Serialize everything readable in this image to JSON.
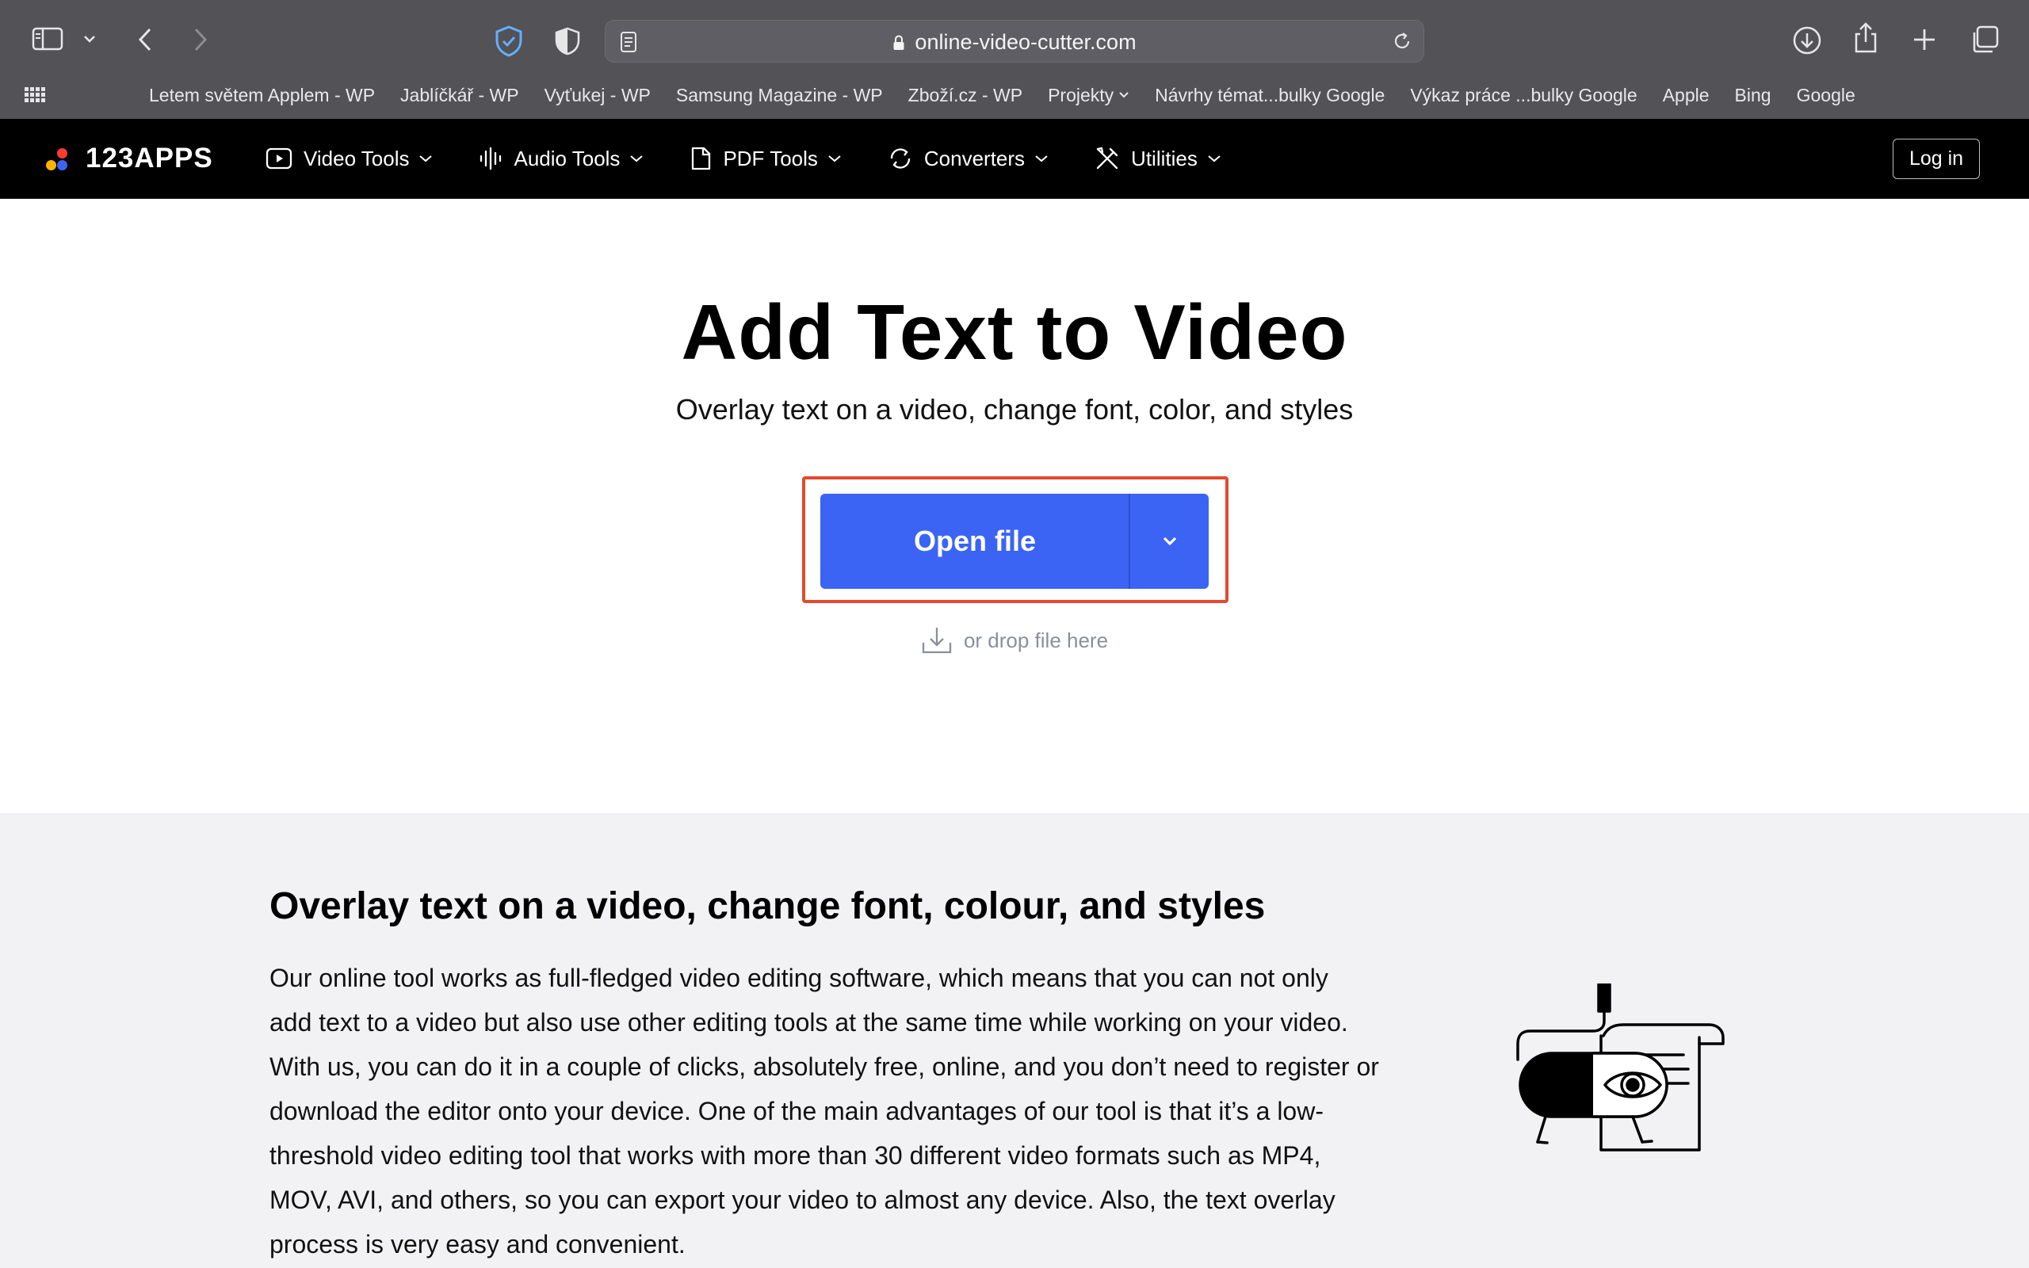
{
  "browser": {
    "url": "online-video-cutter.com",
    "bookmarks": [
      {
        "label": "Letem světem Applem - WP"
      },
      {
        "label": "Jablíčkář - WP"
      },
      {
        "label": "Vyťukej - WP"
      },
      {
        "label": "Samsung Magazine - WP"
      },
      {
        "label": "Zboží.cz - WP"
      },
      {
        "label": "Projekty",
        "has_dropdown": true
      },
      {
        "label": "Návrhy témat...bulky Google"
      },
      {
        "label": "Výkaz práce ...bulky Google"
      },
      {
        "label": "Apple"
      },
      {
        "label": "Bing"
      },
      {
        "label": "Google"
      }
    ]
  },
  "nav": {
    "logo": "123APPS",
    "items": [
      {
        "label": "Video Tools",
        "icon": "video-play-icon"
      },
      {
        "label": "Audio Tools",
        "icon": "audio-wave-icon"
      },
      {
        "label": "PDF Tools",
        "icon": "pdf-file-icon"
      },
      {
        "label": "Converters",
        "icon": "convert-icon"
      },
      {
        "label": "Utilities",
        "icon": "tools-icon"
      }
    ],
    "login_label": "Log in"
  },
  "hero": {
    "title": "Add Text to Video",
    "subtitle": "Overlay text on a video, change font, color, and styles",
    "open_file_label": "Open file",
    "drop_hint": "or drop file here"
  },
  "info": {
    "title": "Overlay text on a video, change font, colour, and styles",
    "body_lines": [
      "Our online tool works as full-fledged video editing software, which means that you can not only",
      "add text to a video but also use other editing tools at the same time while working on your video.",
      "With us, you can do it in a couple of clicks, absolutely free, online, and you don’t need to register or",
      "download the editor onto your device. One of the main advantages of our tool is that it’s a low-",
      "threshold video editing tool that works with more than 30 different video formats such as MP4,",
      "MOV, AVI, and others, so you can export your video to almost any device. Also, the text overlay",
      "process is very easy and convenient."
    ]
  },
  "colors": {
    "primary_button": "#3b64f5",
    "highlight": "#e44a2e",
    "logo_dots": [
      "#ffb400",
      "#3b64f5",
      "#ff3b30"
    ]
  }
}
